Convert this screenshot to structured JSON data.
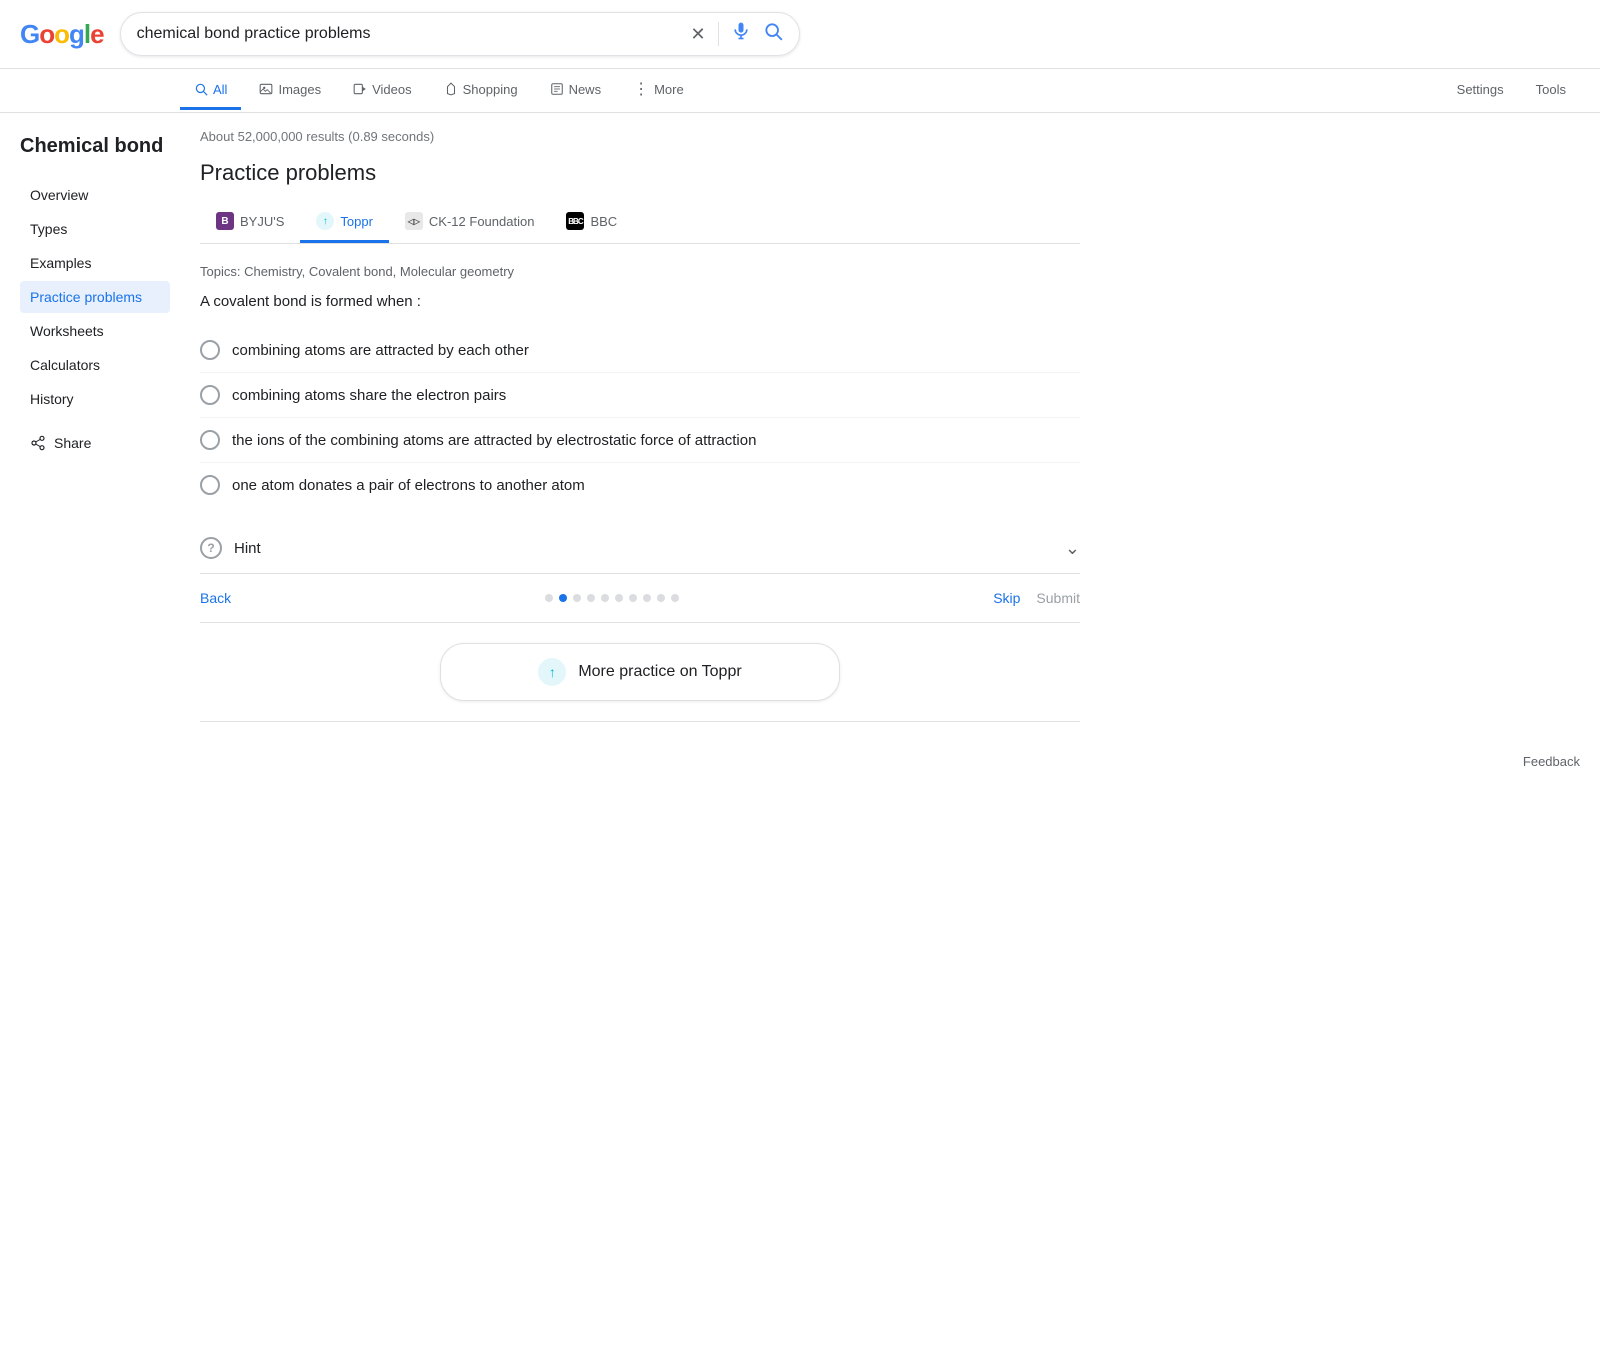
{
  "header": {
    "logo_letters": [
      "G",
      "o",
      "o",
      "g",
      "l",
      "e"
    ],
    "search_value": "chemical bond practice problems",
    "clear_icon": "×",
    "mic_icon": "🎤",
    "search_icon": "🔍"
  },
  "nav": {
    "tabs": [
      {
        "id": "all",
        "label": "All",
        "icon": "🔍",
        "active": true
      },
      {
        "id": "images",
        "label": "Images",
        "icon": "🖼"
      },
      {
        "id": "videos",
        "label": "Videos",
        "icon": "▶"
      },
      {
        "id": "shopping",
        "label": "Shopping",
        "icon": "◇"
      },
      {
        "id": "news",
        "label": "News",
        "icon": "📰"
      },
      {
        "id": "more",
        "label": "More",
        "icon": "⋮"
      }
    ],
    "right_tabs": [
      {
        "id": "settings",
        "label": "Settings"
      },
      {
        "id": "tools",
        "label": "Tools"
      }
    ]
  },
  "sidebar": {
    "title": "Chemical bond",
    "items": [
      {
        "id": "overview",
        "label": "Overview",
        "active": false
      },
      {
        "id": "types",
        "label": "Types",
        "active": false
      },
      {
        "id": "examples",
        "label": "Examples",
        "active": false
      },
      {
        "id": "practice",
        "label": "Practice problems",
        "active": true
      },
      {
        "id": "worksheets",
        "label": "Worksheets",
        "active": false
      },
      {
        "id": "calculators",
        "label": "Calculators",
        "active": false
      },
      {
        "id": "history",
        "label": "History",
        "active": false
      }
    ],
    "share_label": "Share"
  },
  "content": {
    "results_info": "About 52,000,000 results (0.89 seconds)",
    "section_title": "Practice problems",
    "source_tabs": [
      {
        "id": "byjus",
        "label": "BYJU'S",
        "icon_type": "byjus",
        "icon_text": "B",
        "active": false
      },
      {
        "id": "toppr",
        "label": "Toppr",
        "icon_type": "toppr",
        "icon_text": "↑",
        "active": true
      },
      {
        "id": "ck12",
        "label": "CK-12 Foundation",
        "icon_type": "ck12",
        "icon_text": "◁▷",
        "active": false
      },
      {
        "id": "bbc",
        "label": "BBC",
        "icon_type": "bbc",
        "icon_text": "BBC",
        "active": false
      }
    ],
    "topics": "Topics: Chemistry, Covalent bond, Molecular geometry",
    "question": "A covalent bond is formed when :",
    "options": [
      {
        "id": "a",
        "text": "combining atoms are attracted by each other"
      },
      {
        "id": "b",
        "text": "combining atoms share the electron pairs"
      },
      {
        "id": "c",
        "text": "the ions of the combining atoms are attracted by electrostatic force of attraction"
      },
      {
        "id": "d",
        "text": "one atom donates a pair of electrons to another atom"
      }
    ],
    "hint_label": "Hint",
    "nav_back": "Back",
    "dots": [
      {
        "active": false
      },
      {
        "active": true
      },
      {
        "active": false
      },
      {
        "active": false
      },
      {
        "active": false
      },
      {
        "active": false
      },
      {
        "active": false
      },
      {
        "active": false
      },
      {
        "active": false
      },
      {
        "active": false
      }
    ],
    "nav_skip": "Skip",
    "nav_submit": "Submit",
    "more_practice_label": "More practice on Toppr",
    "feedback_label": "Feedback"
  }
}
